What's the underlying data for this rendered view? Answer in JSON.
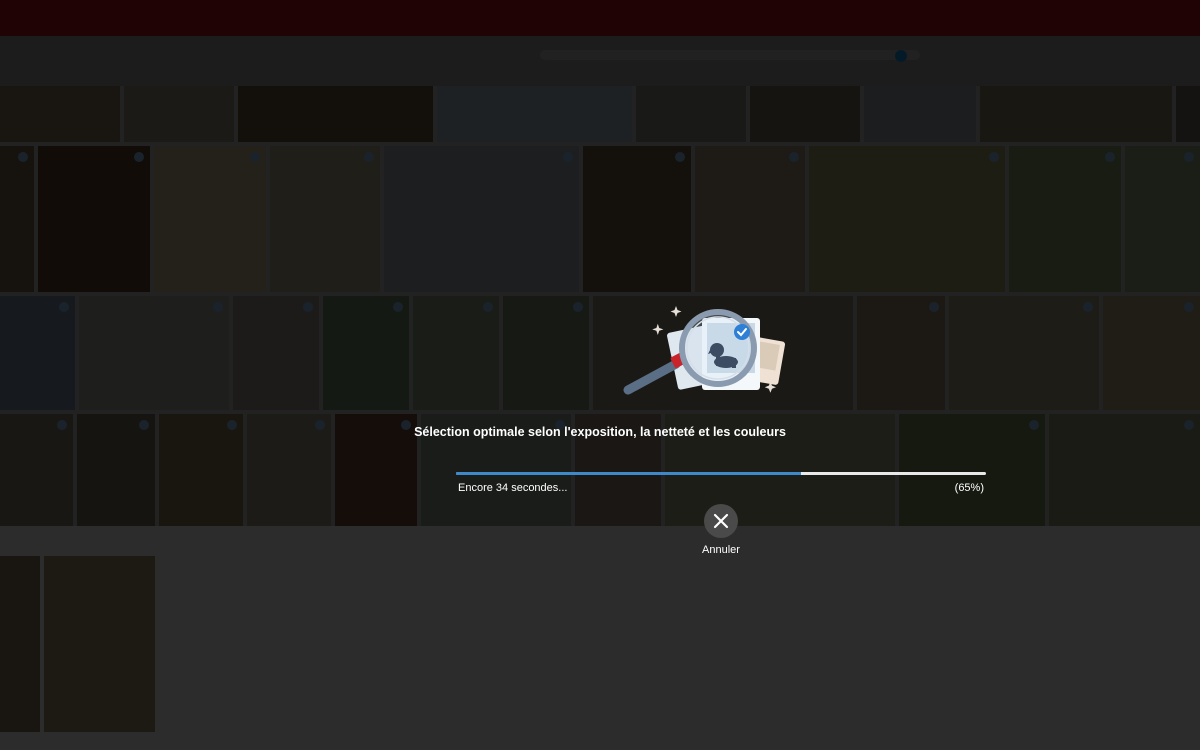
{
  "overlay": {
    "message": "Sélection optimale selon l'exposition, la netteté et les couleurs",
    "remaining": "Encore 34 secondes...",
    "percent_label": "(65%)",
    "progress_fraction": 0.65,
    "cancel_label": "Annuler",
    "accent_color": "#3d89c9",
    "illustration_icons": [
      "magnifier-icon",
      "photo-stack-icon",
      "dog-photo-icon",
      "checkmark-icon",
      "sparkle-icon"
    ],
    "cancel_icon": "close-icon"
  },
  "colors": {
    "topbar": "#b3151b",
    "selected_check": "#1e8fe0"
  }
}
